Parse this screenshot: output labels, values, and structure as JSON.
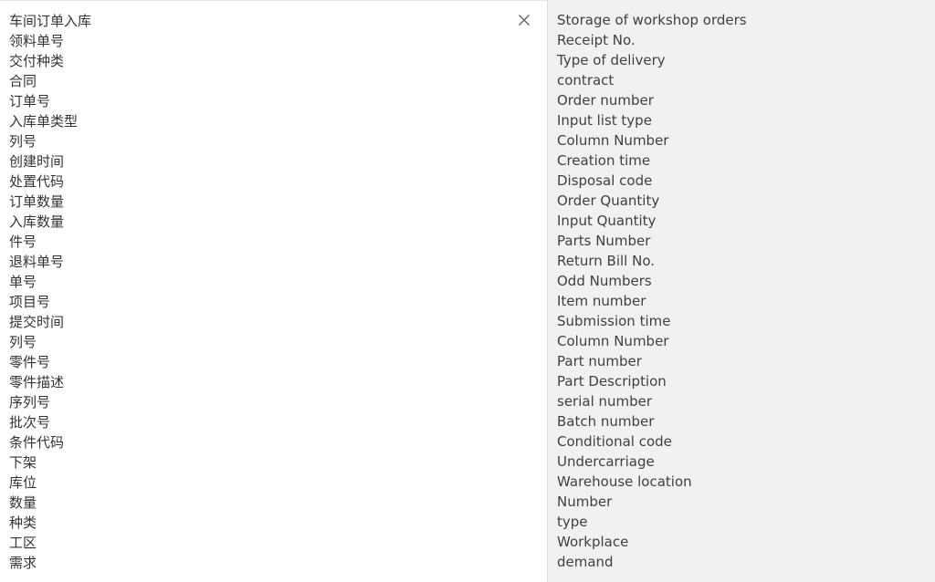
{
  "source": {
    "lines": [
      "车间订单入库",
      "领料单号",
      "交付种类",
      "合同",
      "订单号",
      "入库单类型",
      "列号",
      "创建时间",
      "处置代码",
      "订单数量",
      "入库数量",
      "件号",
      "退料单号",
      "单号",
      "项目号",
      "提交时间",
      "列号",
      "零件号",
      "零件描述",
      "序列号",
      "批次号",
      "条件代码",
      "下架",
      "库位",
      "数量",
      "种类",
      "工区",
      "需求"
    ]
  },
  "target": {
    "lines": [
      "Storage of workshop orders",
      "Receipt No.",
      "Type of delivery",
      "contract",
      "Order number",
      "Input list type",
      "Column Number",
      "Creation time",
      "Disposal code",
      "Order Quantity",
      "Input Quantity",
      "Parts Number",
      "Return Bill No.",
      "Odd Numbers",
      "Item number",
      "Submission time",
      "Column Number",
      "Part number",
      "Part Description",
      "serial number",
      "Batch number",
      "Conditional code",
      "Undercarriage",
      "Warehouse location",
      "Number",
      "type",
      "Workplace",
      "demand"
    ]
  },
  "icons": {
    "clear": "close-icon"
  },
  "colors": {
    "source_bg": "#ffffff",
    "target_bg": "#f1f1f1",
    "text": "#333333"
  }
}
